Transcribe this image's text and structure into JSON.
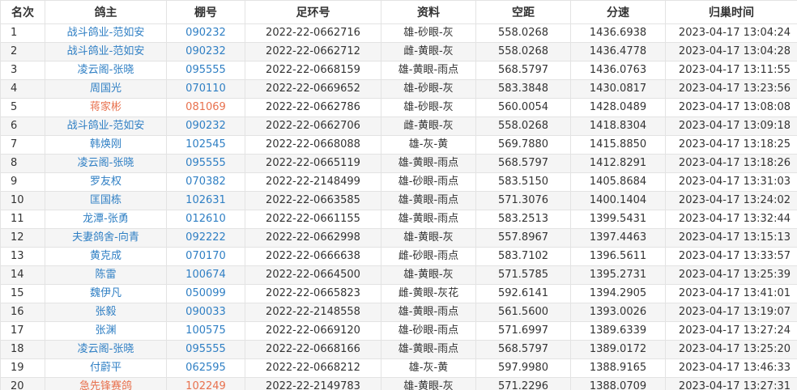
{
  "table": {
    "headers": [
      "名次",
      "鸽主",
      "棚号",
      "足环号",
      "资料",
      "空距",
      "分速",
      "归巢时间"
    ],
    "rows": [
      {
        "rank": "1",
        "owner": "战斗鸽业-范如安",
        "loft": "090232",
        "ring": "2022-22-0662716",
        "info": "雄-砂眼-灰",
        "distance": "558.0268",
        "speed": "1436.6938",
        "time": "2023-04-17 13:04:24",
        "highlight": false
      },
      {
        "rank": "2",
        "owner": "战斗鸽业-范如安",
        "loft": "090232",
        "ring": "2022-22-0662712",
        "info": "雌-黄眼-灰",
        "distance": "558.0268",
        "speed": "1436.4778",
        "time": "2023-04-17 13:04:28",
        "highlight": false
      },
      {
        "rank": "3",
        "owner": "凌云阁-张晓",
        "loft": "095555",
        "ring": "2022-22-0668159",
        "info": "雄-黄眼-雨点",
        "distance": "568.5797",
        "speed": "1436.0763",
        "time": "2023-04-17 13:11:55",
        "highlight": false
      },
      {
        "rank": "4",
        "owner": "周国光",
        "loft": "070110",
        "ring": "2022-22-0669652",
        "info": "雄-砂眼-灰",
        "distance": "583.3848",
        "speed": "1430.0817",
        "time": "2023-04-17 13:23:56",
        "highlight": false
      },
      {
        "rank": "5",
        "owner": "蒋家彬",
        "loft": "081069",
        "ring": "2022-22-0662786",
        "info": "雄-砂眼-灰",
        "distance": "560.0054",
        "speed": "1428.0489",
        "time": "2023-04-17 13:08:08",
        "highlight": true
      },
      {
        "rank": "6",
        "owner": "战斗鸽业-范如安",
        "loft": "090232",
        "ring": "2022-22-0662706",
        "info": "雌-黄眼-灰",
        "distance": "558.0268",
        "speed": "1418.8304",
        "time": "2023-04-17 13:09:18",
        "highlight": false
      },
      {
        "rank": "7",
        "owner": "韩焕刚",
        "loft": "102545",
        "ring": "2022-22-0668088",
        "info": "雄-灰-黄",
        "distance": "569.7880",
        "speed": "1415.8850",
        "time": "2023-04-17 13:18:25",
        "highlight": false
      },
      {
        "rank": "8",
        "owner": "凌云阁-张晓",
        "loft": "095555",
        "ring": "2022-22-0665119",
        "info": "雄-黄眼-雨点",
        "distance": "568.5797",
        "speed": "1412.8291",
        "time": "2023-04-17 13:18:26",
        "highlight": false
      },
      {
        "rank": "9",
        "owner": "罗友权",
        "loft": "070382",
        "ring": "2022-22-2148499",
        "info": "雄-砂眼-雨点",
        "distance": "583.5150",
        "speed": "1405.8684",
        "time": "2023-04-17 13:31:03",
        "highlight": false
      },
      {
        "rank": "10",
        "owner": "匡国栋",
        "loft": "102631",
        "ring": "2022-22-0663585",
        "info": "雄-黄眼-雨点",
        "distance": "571.3076",
        "speed": "1400.1404",
        "time": "2023-04-17 13:24:02",
        "highlight": false
      },
      {
        "rank": "11",
        "owner": "龙潭-张勇",
        "loft": "012610",
        "ring": "2022-22-0661155",
        "info": "雄-黄眼-雨点",
        "distance": "583.2513",
        "speed": "1399.5431",
        "time": "2023-04-17 13:32:44",
        "highlight": false
      },
      {
        "rank": "12",
        "owner": "夫妻鸽舍-向青",
        "loft": "092222",
        "ring": "2022-22-0662998",
        "info": "雄-黄眼-灰",
        "distance": "557.8967",
        "speed": "1397.4463",
        "time": "2023-04-17 13:15:13",
        "highlight": false
      },
      {
        "rank": "13",
        "owner": "黄克成",
        "loft": "070170",
        "ring": "2022-22-0666638",
        "info": "雌-砂眼-雨点",
        "distance": "583.7102",
        "speed": "1396.5611",
        "time": "2023-04-17 13:33:57",
        "highlight": false
      },
      {
        "rank": "14",
        "owner": "陈雷",
        "loft": "100674",
        "ring": "2022-22-0664500",
        "info": "雄-黄眼-灰",
        "distance": "571.5785",
        "speed": "1395.2731",
        "time": "2023-04-17 13:25:39",
        "highlight": false
      },
      {
        "rank": "15",
        "owner": "魏伊凡",
        "loft": "050099",
        "ring": "2022-22-0665823",
        "info": "雌-黄眼-灰花",
        "distance": "592.6141",
        "speed": "1394.2905",
        "time": "2023-04-17 13:41:01",
        "highlight": false
      },
      {
        "rank": "16",
        "owner": "张毅",
        "loft": "090033",
        "ring": "2022-22-2148558",
        "info": "雄-黄眼-雨点",
        "distance": "561.5600",
        "speed": "1393.0026",
        "time": "2023-04-17 13:19:07",
        "highlight": false
      },
      {
        "rank": "17",
        "owner": "张渊",
        "loft": "100575",
        "ring": "2022-22-0669120",
        "info": "雄-砂眼-雨点",
        "distance": "571.6997",
        "speed": "1389.6339",
        "time": "2023-04-17 13:27:24",
        "highlight": false
      },
      {
        "rank": "18",
        "owner": "凌云阁-张晓",
        "loft": "095555",
        "ring": "2022-22-0668166",
        "info": "雄-黄眼-雨点",
        "distance": "568.5797",
        "speed": "1389.0172",
        "time": "2023-04-17 13:25:20",
        "highlight": false
      },
      {
        "rank": "19",
        "owner": "付蔚平",
        "loft": "062595",
        "ring": "2022-22-0668212",
        "info": "雄-灰-黄",
        "distance": "597.9980",
        "speed": "1388.9165",
        "time": "2023-04-17 13:46:33",
        "highlight": false
      },
      {
        "rank": "20",
        "owner": "急先锋赛鸽",
        "loft": "102249",
        "ring": "2022-22-2149783",
        "info": "雄-黄眼-灰",
        "distance": "571.2296",
        "speed": "1388.0709",
        "time": "2023-04-17 13:27:31",
        "highlight": true
      }
    ]
  },
  "colors": {
    "link": "#2f7fc4",
    "highlight": "#e8714e",
    "stripe": "#f5f5f5",
    "border": "#e3e3e3"
  }
}
